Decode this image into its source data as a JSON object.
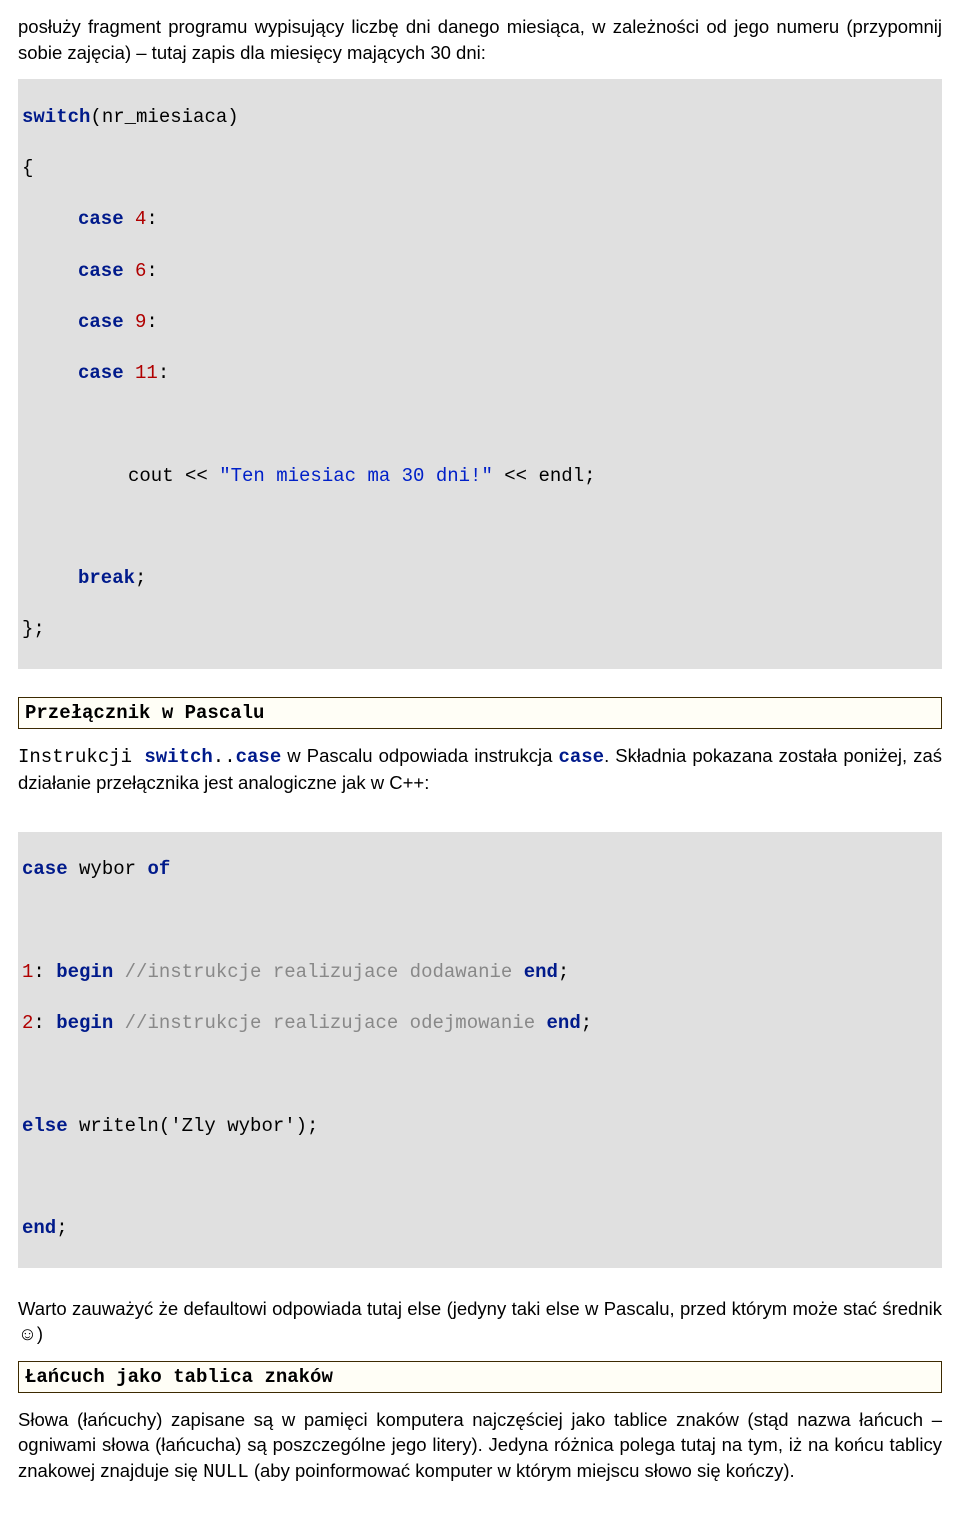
{
  "intro_para": "posłuży fragment programu wypisujący liczbę dni danego miesiąca, w zależności od jego numeru (przypomnij sobie zajęcia) – tutaj zapis dla miesięcy mających 30 dni:",
  "cpp": {
    "l1_switch": "switch",
    "l1_paren_open": "(",
    "l1_var": "nr_miesiaca",
    "l1_paren_close": ")",
    "l2_brace": "{",
    "c1_case": "case",
    "c1_num": "4",
    "c1_colon": ":",
    "c2_case": "case",
    "c2_num": "6",
    "c2_colon": ":",
    "c3_case": "case",
    "c3_num": "9",
    "c3_colon": ":",
    "c4_case": "case",
    "c4_num": "11",
    "c4_colon": ":",
    "cout_pre": "cout << ",
    "cout_str": "\"Ten miesiac ma 30 dni!\"",
    "cout_post": " << endl;",
    "break": "break",
    "break_semi": ";",
    "close": "};"
  },
  "heading_pascal": "Przełącznik w Pascalu",
  "pascal_intro": {
    "t1": "Instrukcji ",
    "kw_switch": "switch",
    "dots": "..",
    "kw_case": "case",
    "t2": " w Pascalu odpowiada instrukcja ",
    "kw_case2": "case",
    "t3": ". Składnia pokazana została poniżej, zaś działanie przełącznika jest analogiczne jak w C++:"
  },
  "pascal_code": {
    "l1_case": "case",
    "l1_mid": " wybor ",
    "l1_of": "of",
    "l2_num": "1",
    "l2_colon": ": ",
    "l2_begin": "begin",
    "l2_comment": " //instrukcje realizujace dodawanie ",
    "l2_end": "end",
    "l2_semi": ";",
    "l3_num": "2",
    "l3_colon": ": ",
    "l3_begin": "begin",
    "l3_comment": " //instrukcje realizujace odejmowanie ",
    "l3_end": "end",
    "l3_semi": ";",
    "l4_else": "else",
    "l4_rest": " writeln('Zly wybor');",
    "l5_end": "end",
    "l5_semi": ";"
  },
  "pascal_note": "Warto zauważyć że defaultowi odpowiada tutaj else (jedyny taki else w Pascalu, przed którym może stać średnik ☺)",
  "heading_lancuch": "Łańcuch jako tablica znaków",
  "lancuch_para_pre": "Słowa (łańcuchy) zapisane są w pamięci komputera najczęściej jako tablice znaków (stąd nazwa łańcuch – ogniwami słowa (łańcucha) są poszczególne jego litery). Jedyna różnica polega tutaj na tym, iż na końcu tablicy znakowej znajduje się ",
  "lancuch_null": "NULL",
  "lancuch_para_post": " (aby poinformować komputer w którym miejscu  słowo się kończy)."
}
